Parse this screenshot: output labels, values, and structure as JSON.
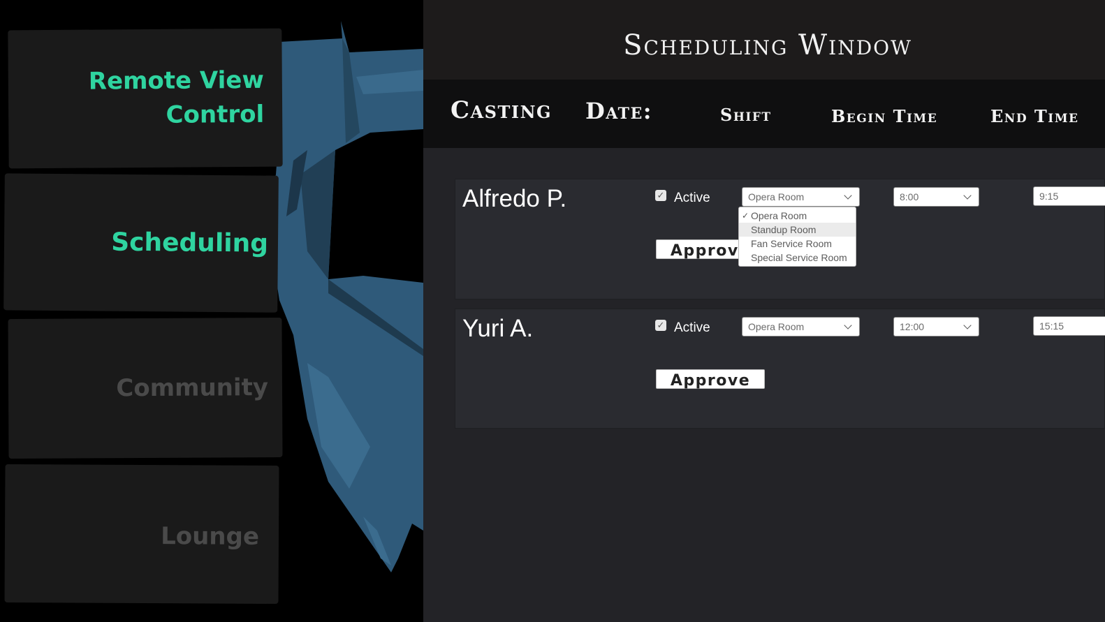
{
  "nav": {
    "remote_view_line1": "Remote View",
    "remote_view_line2": "Control",
    "scheduling": "Scheduling",
    "community": "Community",
    "lounge": "Lounge"
  },
  "panel": {
    "title": "Scheduling Window",
    "headers": {
      "casting": "Casting",
      "date": "Date:",
      "shift": "Shift",
      "begin_time": "Begin Time",
      "end_time": "End Time"
    }
  },
  "rows": [
    {
      "name": "Alfredo P.",
      "active_label": "Active",
      "active": true,
      "room": "Opera Room",
      "begin": "8:00",
      "end": "9:15",
      "approve_label": "Approve"
    },
    {
      "name": "Yuri A.",
      "active_label": "Active",
      "active": true,
      "room": "Opera Room",
      "begin": "12:00",
      "end": "15:15",
      "approve_label": "Approve"
    }
  ],
  "room_dropdown": {
    "open": true,
    "selected": "Opera Room",
    "highlighted": "Standup Room",
    "options": [
      "Opera Room",
      "Standup Room",
      "Fan Service Room",
      "Special Service Room"
    ]
  },
  "colors": {
    "accent": "#2fd4a0",
    "dim_nav": "#4a4a4a",
    "scene_blue": "#2f5a7a"
  }
}
